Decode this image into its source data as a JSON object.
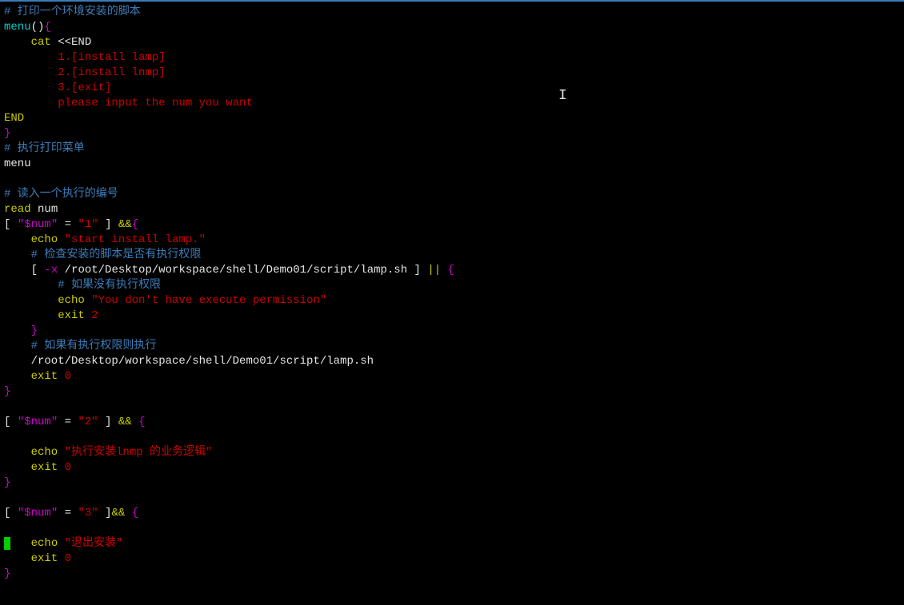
{
  "lines": {
    "l1_comment": "# 打印一个环境安装的脚本",
    "l2_menu": "menu",
    "l2_paren": "()",
    "l2_brace": "{",
    "l3_cat": "    cat ",
    "l3_heredoc": "<<END",
    "l4": "        1.[install lamp]",
    "l5": "        2.[install lnmp]",
    "l6": "        3.[exit]",
    "l7": "        please input the num you want",
    "l8": "END",
    "l9": "}",
    "l10_comment": "# 执行打印菜单",
    "l11": "menu",
    "l12": "",
    "l13_comment": "# 读入一个执行的编号",
    "l14_read": "read",
    "l14_num": " num",
    "l15_b1": "[ ",
    "l15_var": "\"$num\"",
    "l15_eq": " = ",
    "l15_val": "\"1\"",
    "l15_b2": " ] ",
    "l15_and": "&&",
    "l15_brace": "{",
    "l16_echo": "    echo ",
    "l16_str": "\"start install lamp.\"",
    "l17_comment": "    # 检查安装的脚本是否有执行权限",
    "l18_b1": "    [ ",
    "l18_x": "-x",
    "l18_path": " /root/Desktop/workspace/shell/Demo01/script/lamp.sh ",
    "l18_b2": "] ",
    "l18_or": "|| ",
    "l18_brace": "{",
    "l19_comment": "        # 如果没有执行权限",
    "l20_echo": "        echo ",
    "l20_str": "\"You don't have execute permission\"",
    "l21_exit": "        exit ",
    "l21_code": "2",
    "l22_brace": "    }",
    "l23_comment": "    # 如果有执行权限则执行",
    "l24": "    /root/Desktop/workspace/shell/Demo01/script/lamp.sh",
    "l25_exit": "    exit ",
    "l25_code": "0",
    "l26_brace": "}",
    "l27": "",
    "l28_b1": "[ ",
    "l28_var": "\"$num\"",
    "l28_eq": " = ",
    "l28_val": "\"2\"",
    "l28_b2": " ] ",
    "l28_and": "&& ",
    "l28_brace": "{",
    "l29": "",
    "l30_echo": "    echo ",
    "l30_str": "\"执行安装lnmp 的业务逻辑\"",
    "l31_exit": "    exit ",
    "l31_code": "0",
    "l32_brace": "}",
    "l33": "",
    "l34_b1": "[ ",
    "l34_var": "\"$num\"",
    "l34_eq": " = ",
    "l34_val": "\"3\"",
    "l34_b2": " ]",
    "l34_and": "&& ",
    "l34_brace": "{",
    "l35": "",
    "l36_cursor": " ",
    "l36_echo": "   echo ",
    "l36_str": "\"退出安装\"",
    "l37_exit": "    exit ",
    "l37_code": "0",
    "l38_brace": "}"
  },
  "cursor_char": "I"
}
